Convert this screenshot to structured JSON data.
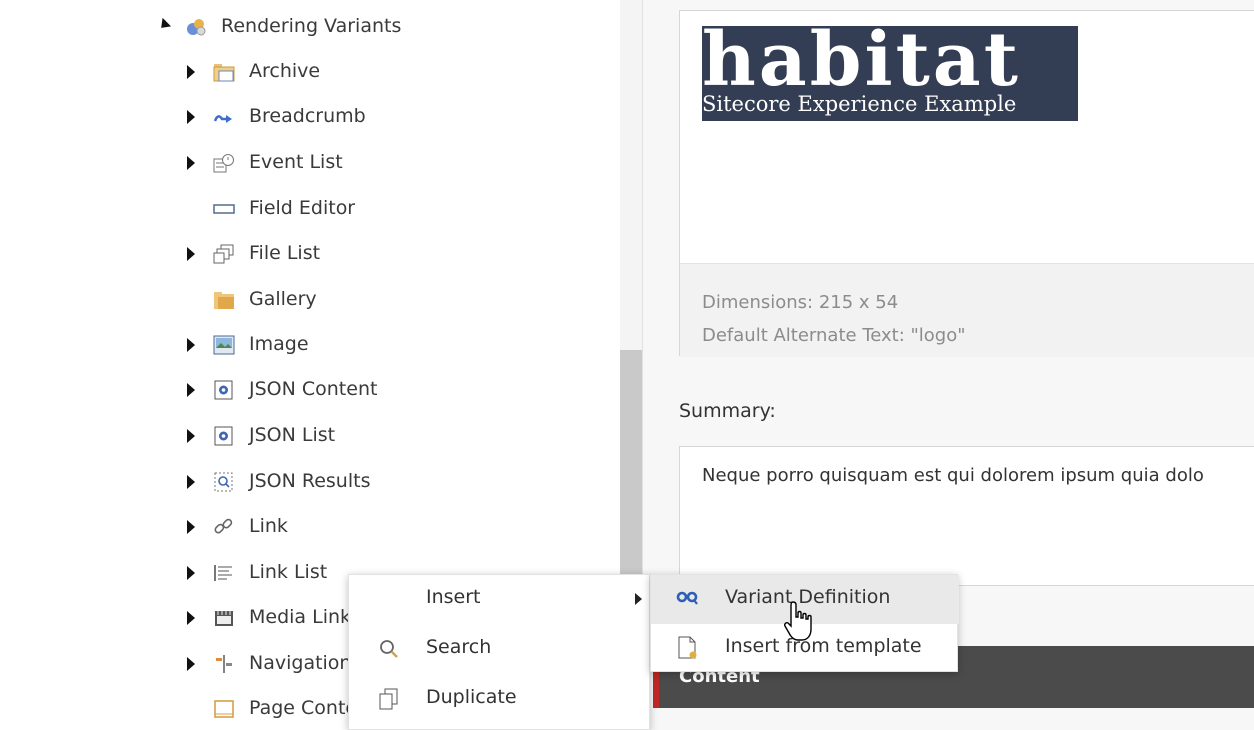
{
  "tree": {
    "parent": {
      "label": "Rendering Variants",
      "icon": "rendering-variants-icon",
      "expanded": true
    },
    "items": [
      {
        "label": "Archive",
        "icon": "archive-folder-icon",
        "has_children": true
      },
      {
        "label": "Breadcrumb",
        "icon": "breadcrumb-icon",
        "has_children": true
      },
      {
        "label": "Event List",
        "icon": "event-list-icon",
        "has_children": true
      },
      {
        "label": "Field Editor",
        "icon": "field-editor-icon",
        "has_children": false
      },
      {
        "label": "File List",
        "icon": "file-list-icon",
        "has_children": true
      },
      {
        "label": "Gallery",
        "icon": "gallery-icon",
        "has_children": false
      },
      {
        "label": "Image",
        "icon": "image-icon",
        "has_children": true
      },
      {
        "label": "JSON Content",
        "icon": "json-content-icon",
        "has_children": true
      },
      {
        "label": "JSON List",
        "icon": "json-list-icon",
        "has_children": true
      },
      {
        "label": "JSON Results",
        "icon": "json-results-icon",
        "has_children": true
      },
      {
        "label": "Link",
        "icon": "link-icon",
        "has_children": true
      },
      {
        "label": "Link List",
        "icon": "link-list-icon",
        "has_children": true
      },
      {
        "label": "Media Link",
        "icon": "media-link-icon",
        "has_children": true
      },
      {
        "label": "Navigation",
        "icon": "navigation-icon",
        "has_children": true
      },
      {
        "label": "Page Content",
        "icon": "page-content-icon",
        "has_children": false
      }
    ]
  },
  "content": {
    "image_field": {
      "logo_word": "habitat",
      "logo_tagline": "Sitecore Experience Example",
      "dimensions": "Dimensions: 215 x 54",
      "alt_text": "Default Alternate Text: \"logo\""
    },
    "summary": {
      "label": "Summary:",
      "value": "Neque porro quisquam est qui dolorem ipsum quia dolo"
    },
    "section_title": "Content"
  },
  "context_menu": {
    "items": [
      {
        "label": "Insert",
        "icon": "",
        "has_submenu": true
      },
      {
        "label": "Search",
        "icon": "search-icon",
        "has_submenu": false
      },
      {
        "label": "Duplicate",
        "icon": "duplicate-icon",
        "has_submenu": false
      }
    ]
  },
  "submenu": {
    "items": [
      {
        "label": "Variant Definition",
        "icon": "variant-definition-icon",
        "hovered": true
      },
      {
        "label": "Insert from template",
        "icon": "insert-from-template-icon",
        "hovered": false
      }
    ]
  },
  "colors": {
    "logo_bg": "#333d53",
    "section_bar": "#4b4b4b",
    "section_accent": "#c22727",
    "hover_bg": "#e9e9e9"
  }
}
